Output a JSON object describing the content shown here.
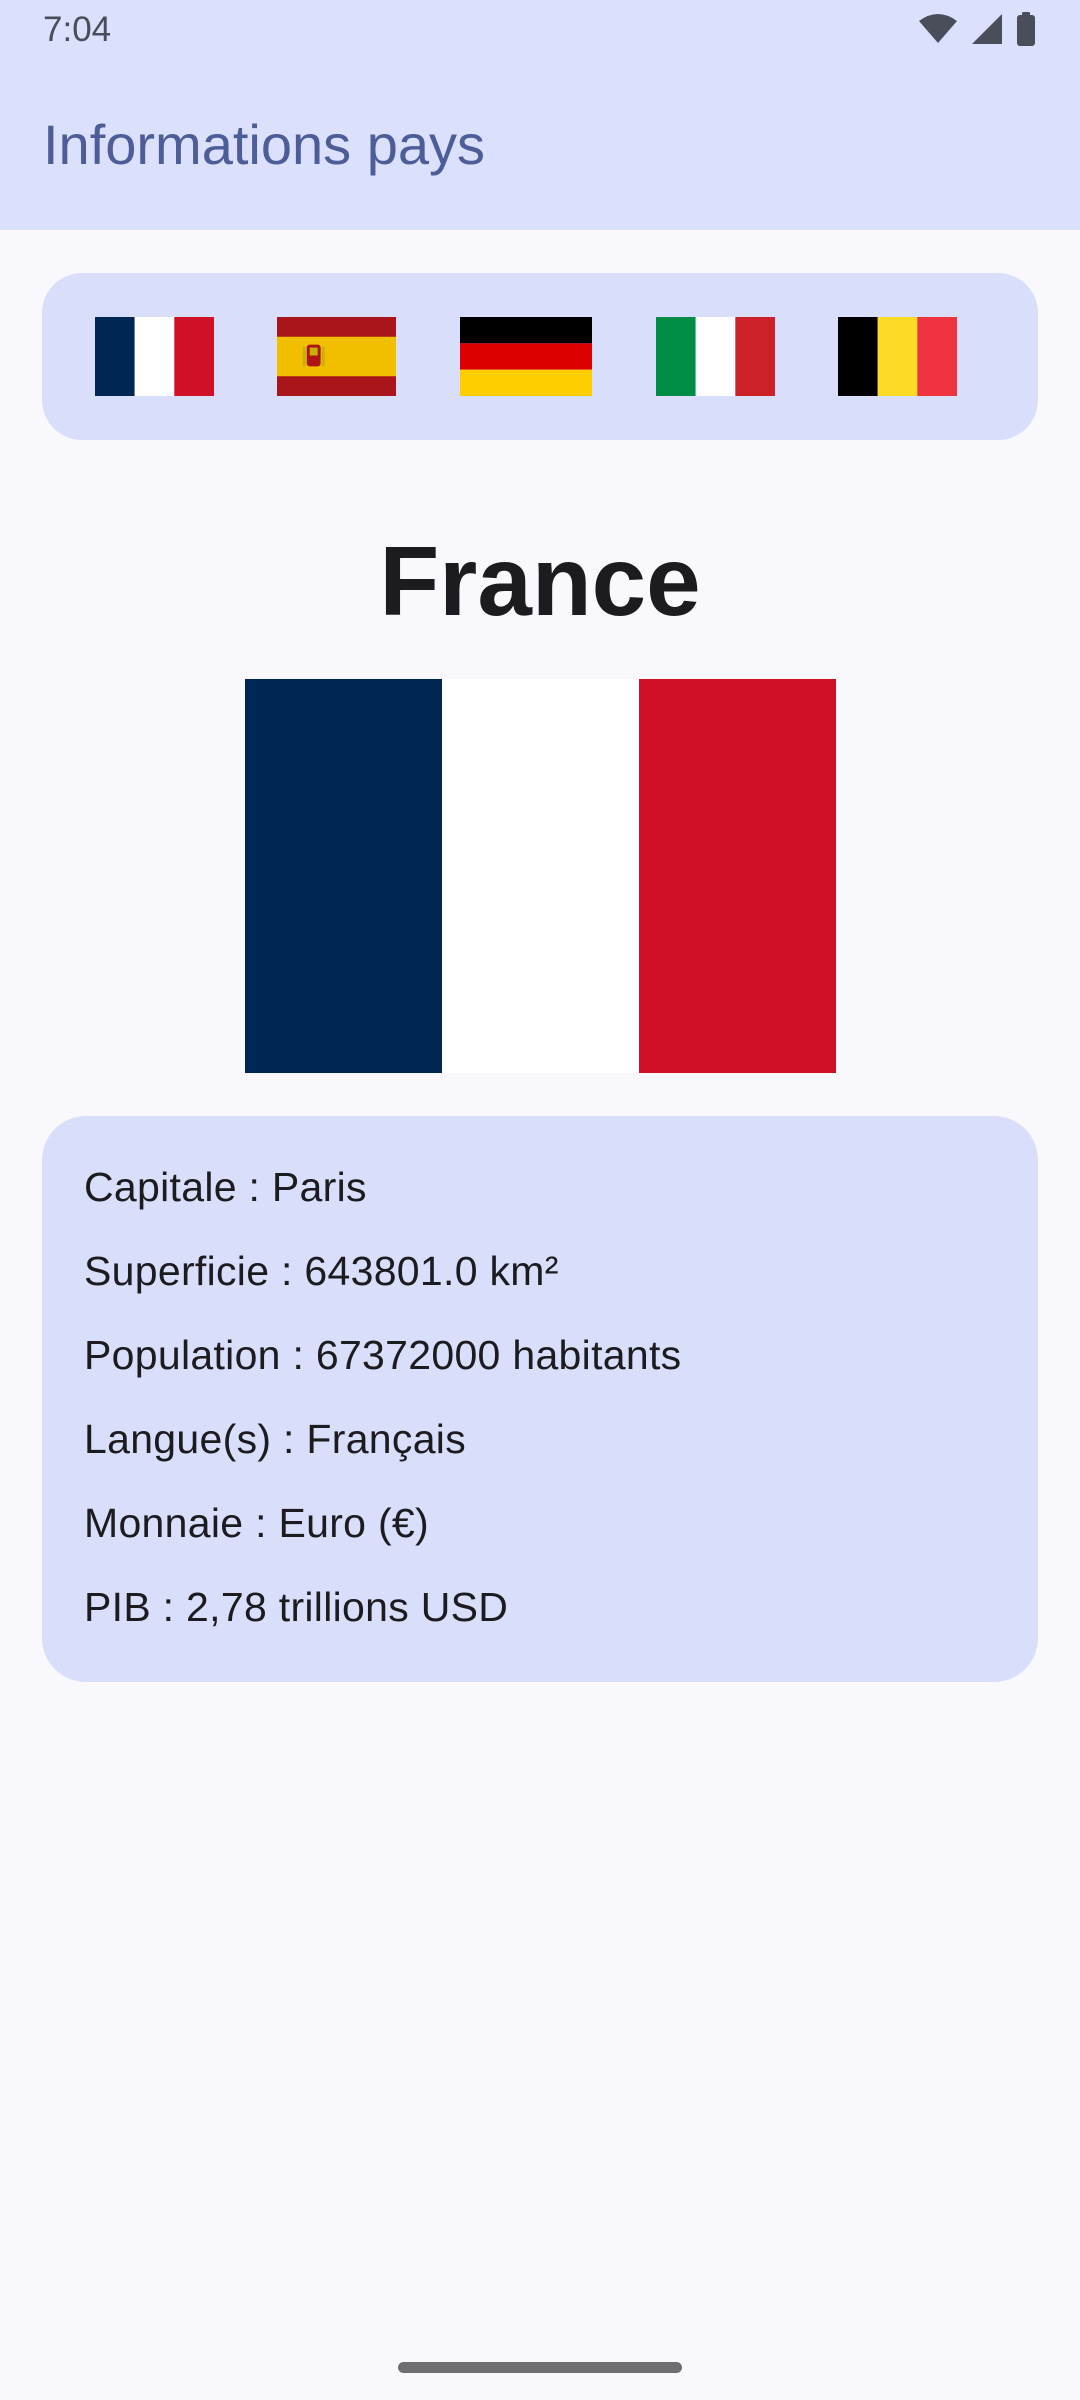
{
  "status_bar": {
    "time": "7:04",
    "icons": [
      "wifi-icon",
      "signal-icon",
      "battery-icon"
    ]
  },
  "app_bar": {
    "title": "Informations pays"
  },
  "flag_selector": {
    "flags": [
      {
        "country": "France",
        "icon": "flag-france-icon"
      },
      {
        "country": "Espagne",
        "icon": "flag-spain-icon"
      },
      {
        "country": "Allemagne",
        "icon": "flag-germany-icon"
      },
      {
        "country": "Italie",
        "icon": "flag-italy-icon"
      },
      {
        "country": "Belgique",
        "icon": "flag-belgium-icon"
      }
    ]
  },
  "selected_country": {
    "name": "France",
    "flag_colors": [
      "#002654",
      "#ffffff",
      "#ce1126"
    ],
    "info": {
      "capital": "Capitale : Paris",
      "area": "Superficie : 643801.0 km²",
      "population": "Population : 67372000 habitants",
      "languages": "Langue(s) : Français",
      "currency": "Monnaie : Euro (€)",
      "gdp": "PIB : 2,78 trillions USD"
    }
  },
  "colors": {
    "app_bar_bg": "#dbe0fc",
    "card_bg": "#d9defb",
    "title": "#4c5d97",
    "page_bg": "#f8f8fd"
  }
}
